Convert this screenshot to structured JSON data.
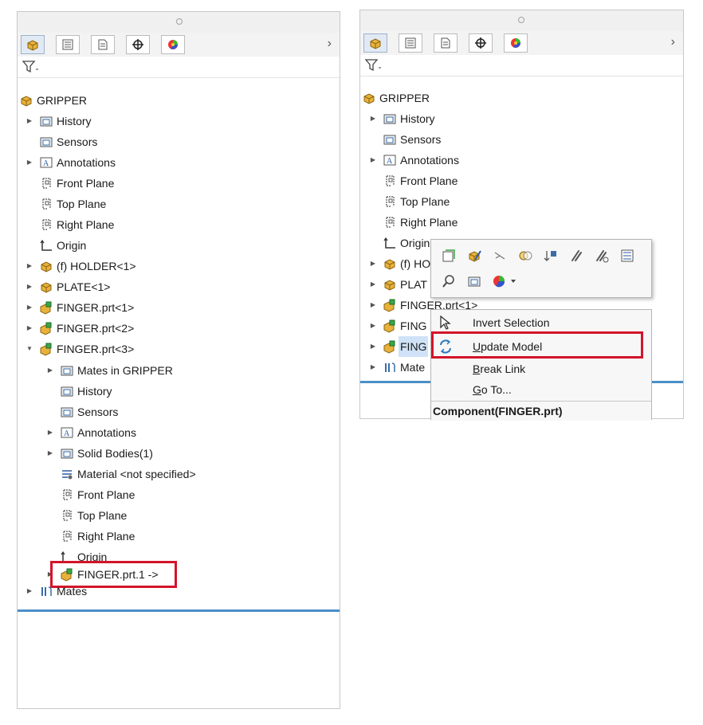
{
  "left": {
    "root": "GRIPPER",
    "items": [
      {
        "label": "History"
      },
      {
        "label": "Sensors"
      },
      {
        "label": "Annotations"
      },
      {
        "label": "Front Plane"
      },
      {
        "label": "Top Plane"
      },
      {
        "label": "Right Plane"
      },
      {
        "label": "Origin"
      },
      {
        "label": "(f) HOLDER<1>"
      },
      {
        "label": "PLATE<1>"
      },
      {
        "label": "FINGER.prt<1>"
      },
      {
        "label": "FINGER.prt<2>"
      },
      {
        "label": "FINGER.prt<3>"
      }
    ],
    "sub_items": [
      {
        "label": "Mates in GRIPPER"
      },
      {
        "label": "History"
      },
      {
        "label": "Sensors"
      },
      {
        "label": "Annotations"
      },
      {
        "label": "Solid Bodies(1)"
      },
      {
        "label": "Material <not specified>"
      },
      {
        "label": "Front Plane"
      },
      {
        "label": "Top Plane"
      },
      {
        "label": "Right Plane"
      },
      {
        "label": "Origin"
      },
      {
        "label": "FINGER.prt.1 ->"
      }
    ],
    "mates": "Mates"
  },
  "right": {
    "root": "GRIPPER",
    "items": [
      {
        "label": "History"
      },
      {
        "label": "Sensors"
      },
      {
        "label": "Annotations"
      },
      {
        "label": "Front Plane"
      },
      {
        "label": "Top Plane"
      },
      {
        "label": "Right Plane"
      },
      {
        "label": "Origin"
      },
      {
        "label": "(f) HO"
      },
      {
        "label": "PLAT"
      },
      {
        "label": "FINGER.prt<1>"
      },
      {
        "label": "FING"
      },
      {
        "label": "FING"
      },
      {
        "label": "Mate"
      }
    ]
  },
  "context_menu": {
    "items": [
      {
        "label": "Invert Selection"
      },
      {
        "pre": "",
        "ul": "U",
        "post": "pdate Model"
      },
      {
        "pre": "",
        "ul": "B",
        "post": "reak Link"
      },
      {
        "pre": "",
        "ul": "G",
        "post": "o To..."
      }
    ],
    "header": "Component(FINGER.prt)"
  },
  "colors": {
    "highlight_box": "#d3142a",
    "separator": "#4a8fc8",
    "selection": "#cfe2f7"
  },
  "icons": {
    "tabs": [
      "feature-manager-icon",
      "property-manager-icon",
      "configuration-manager-icon",
      "dimxpert-icon",
      "display-manager-icon"
    ],
    "filter": "filter-icon"
  }
}
